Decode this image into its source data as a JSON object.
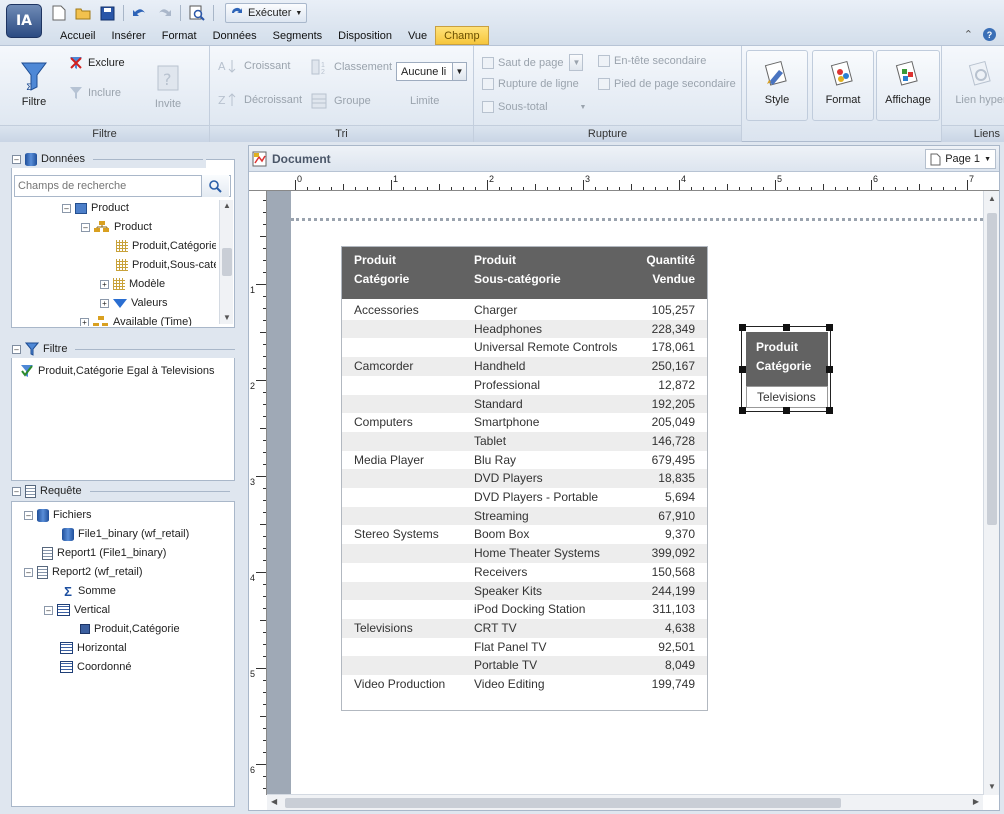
{
  "app": {
    "logo_text": "IA"
  },
  "toolbar": {
    "run_label": "Exécuter"
  },
  "menu": [
    "Accueil",
    "Insérer",
    "Format",
    "Données",
    "Segments",
    "Disposition",
    "Vue",
    "Champ"
  ],
  "ribbon": {
    "filter": {
      "group_label": "Filtre",
      "filtre": "Filtre",
      "exclure": "Exclure",
      "inclure": "Inclure",
      "invite": "Invite"
    },
    "sort": {
      "group_label": "Tri",
      "croissant": "Croissant",
      "decroissant": "Décroissant",
      "classement": "Classement",
      "groupe": "Groupe",
      "limit_value": "Aucune li",
      "limite": "Limite"
    },
    "break": {
      "group_label": "Rupture",
      "saut_de_page": "Saut de page",
      "rupture_de_ligne": "Rupture de ligne",
      "sous_total": "Sous-total",
      "entete_secondaire": "En-tête secondaire",
      "pied_secondaire": "Pied de page secondaire"
    },
    "big": {
      "style": "Style",
      "format": "Format",
      "affichage": "Affichage",
      "lien_hyper": "Lien hyper"
    },
    "links_group_label": "Liens"
  },
  "data_panel": {
    "title": "Données",
    "search_placeholder": "Champs de recherche",
    "tree": [
      "Product",
      "Product",
      "Produit,Catégorie",
      "Produit,Sous-catégorie",
      "Modèle",
      "Valeurs",
      "Available (Time)"
    ]
  },
  "filter_panel": {
    "title": "Filtre",
    "item": "Produit,Catégorie Egal à Televisions"
  },
  "query_panel": {
    "title": "Requête",
    "tree": [
      "Fichiers",
      "File1_binary (wf_retail)",
      "Report1 (File1_binary)",
      "Report2 (wf_retail)",
      "Somme",
      "Vertical",
      "Produit,Catégorie",
      "Horizontal",
      "Coordonné"
    ]
  },
  "document": {
    "title": "Document",
    "page_label": "Page 1",
    "ruler_h": [
      "0",
      "1",
      "2",
      "3",
      "4",
      "5",
      "6",
      "7"
    ],
    "ruler_v": [
      "1",
      "2",
      "3",
      "4",
      "5",
      "6"
    ]
  },
  "report": {
    "headers": [
      [
        "Produit",
        "Catégorie"
      ],
      [
        "Produit",
        "Sous-catégorie"
      ],
      [
        "Quantité",
        "Vendue"
      ]
    ],
    "rows": [
      [
        "Accessories",
        "Charger",
        "105,257"
      ],
      [
        "",
        "Headphones",
        "228,349"
      ],
      [
        "",
        "Universal Remote Controls",
        "178,061"
      ],
      [
        "Camcorder",
        "Handheld",
        "250,167"
      ],
      [
        "",
        "Professional",
        "12,872"
      ],
      [
        "",
        "Standard",
        "192,205"
      ],
      [
        "Computers",
        "Smartphone",
        "205,049"
      ],
      [
        "",
        "Tablet",
        "146,728"
      ],
      [
        "Media Player",
        "Blu Ray",
        "679,495"
      ],
      [
        "",
        "DVD Players",
        "18,835"
      ],
      [
        "",
        "DVD Players - Portable",
        "5,694"
      ],
      [
        "",
        "Streaming",
        "67,910"
      ],
      [
        "Stereo Systems",
        "Boom Box",
        "9,370"
      ],
      [
        "",
        "Home Theater Systems",
        "399,092"
      ],
      [
        "",
        "Receivers",
        "150,568"
      ],
      [
        "",
        "Speaker Kits",
        "244,199"
      ],
      [
        "",
        "iPod Docking Station",
        "311,103"
      ],
      [
        "Televisions",
        "CRT TV",
        "4,638"
      ],
      [
        "",
        "Flat Panel TV",
        "92,501"
      ],
      [
        "",
        "Portable TV",
        "8,049"
      ],
      [
        "Video Production",
        "Video Editing",
        "199,749"
      ]
    ]
  },
  "filter_widget": {
    "header_1": "Produit",
    "header_2": "Catégorie",
    "value": "Televisions"
  }
}
